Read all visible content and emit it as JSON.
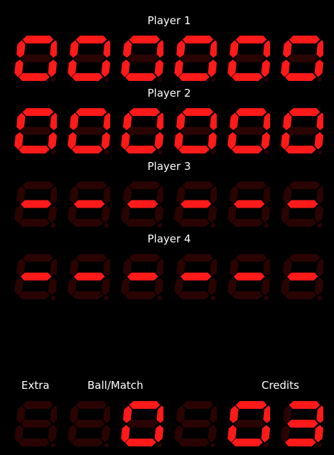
{
  "colors": {
    "on": "#ff1a1a",
    "off": "#2a0303",
    "background": "#000000",
    "label": "#ffffff"
  },
  "players": [
    {
      "label": "Player 1",
      "digits": [
        "0",
        "0",
        "0",
        "0",
        "0",
        "0"
      ]
    },
    {
      "label": "Player 2",
      "digits": [
        "0",
        "0",
        "0",
        "0",
        "0",
        "0"
      ]
    },
    {
      "label": "Player 3",
      "digits": [
        "-",
        "-",
        "-",
        "-",
        "-",
        "-"
      ]
    },
    {
      "label": "Player 4",
      "digits": [
        "-",
        "-",
        "-",
        "-",
        "-",
        "-"
      ]
    }
  ],
  "bottom": {
    "extra_label": "Extra",
    "ball_match_label": "Ball/Match",
    "credits_label": "Credits",
    "extra_digits": [
      " "
    ],
    "ball_match_digits": [
      " ",
      "0"
    ],
    "spacer_digits": [
      " "
    ],
    "credits_digits": [
      "0",
      "3"
    ]
  }
}
